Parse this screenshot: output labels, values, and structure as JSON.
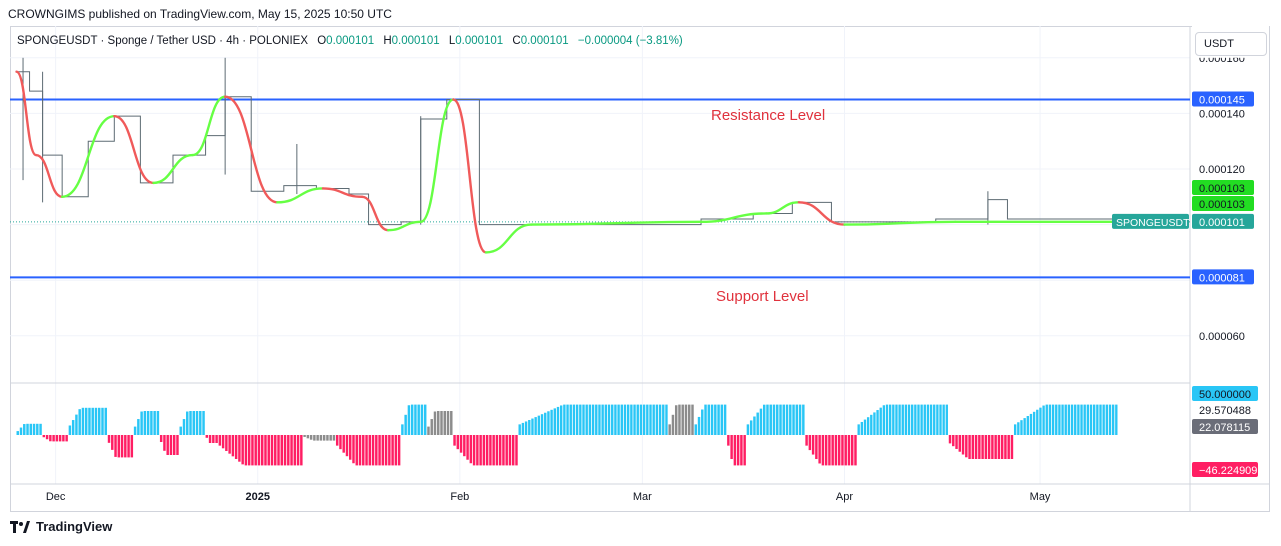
{
  "header": {
    "published": "CROWNGIMS published on TradingView.com, May 15, 2025 10:50 UTC"
  },
  "legend": {
    "symbol": "SPONGEUSDT · Sponge / Tether USD · 4h · POLONIEX",
    "o_label": "O",
    "o_value": "0.000101",
    "h_label": "H",
    "h_value": "0.000101",
    "l_label": "L",
    "l_value": "0.000101",
    "c_label": "C",
    "c_value": "0.000101",
    "change": "−0.000004 (−3.81%)"
  },
  "currency_button": "USDT",
  "annotations": {
    "resistance": "Resistance Level",
    "support": "Support Level"
  },
  "footer": {
    "brand": "TradingView"
  },
  "colors": {
    "level_line": "#2962ff",
    "ma_up": "#66ff44",
    "ma_down": "#f05a5a",
    "osc_pos": "#29c6f6",
    "osc_neg": "#ff1e63",
    "osc_neutral": "#8c8c8c",
    "price_badge": "#26a69a"
  },
  "chart_data": [
    {
      "type": "candlestick",
      "symbol": "SPONGEUSDT",
      "timeframe": "4h",
      "y_axis": {
        "ticks": [
          "0.000140",
          "0.000120",
          "0.000060"
        ],
        "partial_top_tick": "0.000160"
      },
      "x_axis": {
        "labels": [
          "Dec",
          "2025",
          "Feb",
          "Mar",
          "Apr",
          "May"
        ]
      },
      "horizontal_levels": [
        {
          "name": "Resistance Level",
          "value": 0.000145,
          "label": "0.000145"
        },
        {
          "name": "Support Level",
          "value": 8.1e-05,
          "label": "0.000081"
        }
      ],
      "price_labels": [
        {
          "label": "0.000103",
          "color": "#22dd22"
        },
        {
          "label": "0.000103",
          "color": "#22dd22"
        },
        {
          "label": "0.000101",
          "name": "SPONGEUSDT",
          "color": "#26a69a"
        }
      ],
      "close_path": [
        [
          "2024-11-25",
          0.000155
        ],
        [
          "2024-11-27",
          0.000148
        ],
        [
          "2024-11-29",
          0.000125
        ],
        [
          "2024-12-02",
          0.00011
        ],
        [
          "2024-12-06",
          0.00013
        ],
        [
          "2024-12-10",
          0.000139
        ],
        [
          "2024-12-14",
          0.000115
        ],
        [
          "2024-12-19",
          0.000125
        ],
        [
          "2024-12-24",
          0.000132
        ],
        [
          "2024-12-27",
          0.000146
        ],
        [
          "2024-12-31",
          0.000112
        ],
        [
          "2025-01-05",
          0.000114
        ],
        [
          "2025-01-10",
          0.000113
        ],
        [
          "2025-01-15",
          0.000111
        ],
        [
          "2025-01-18",
          0.0001
        ],
        [
          "2025-01-23",
          0.000101
        ],
        [
          "2025-01-26",
          0.000138
        ],
        [
          "2025-01-30",
          0.000145
        ],
        [
          "2025-02-04",
          0.0001
        ],
        [
          "2025-02-10",
          0.0001
        ],
        [
          "2025-03-01",
          0.0001
        ],
        [
          "2025-03-10",
          0.000102
        ],
        [
          "2025-03-18",
          0.000104
        ],
        [
          "2025-03-24",
          0.000108
        ],
        [
          "2025-03-30",
          0.000101
        ],
        [
          "2025-04-15",
          0.000102
        ],
        [
          "2025-04-23",
          0.000109
        ],
        [
          "2025-04-26",
          0.000102
        ],
        [
          "2025-05-15",
          0.000101
        ]
      ],
      "moving_average": [
        [
          "2024-11-25",
          0.000155
        ],
        [
          "2024-11-28",
          0.000125
        ],
        [
          "2024-12-02",
          0.00011
        ],
        [
          "2024-12-10",
          0.000139
        ],
        [
          "2024-12-16",
          0.000115
        ],
        [
          "2024-12-22",
          0.000125
        ],
        [
          "2024-12-27",
          0.000146
        ],
        [
          "2025-01-04",
          0.000108
        ],
        [
          "2025-01-11",
          0.000113
        ],
        [
          "2025-01-17",
          0.00011
        ],
        [
          "2025-01-21",
          9.8e-05
        ],
        [
          "2025-01-26",
          0.000101
        ],
        [
          "2025-01-31",
          0.000145
        ],
        [
          "2025-02-05",
          9e-05
        ],
        [
          "2025-02-12",
          0.0001
        ],
        [
          "2025-03-10",
          0.000101
        ],
        [
          "2025-03-20",
          0.000104
        ],
        [
          "2025-03-25",
          0.000108
        ],
        [
          "2025-04-01",
          0.0001
        ],
        [
          "2025-04-18",
          0.000101
        ],
        [
          "2025-05-15",
          0.000101
        ]
      ]
    },
    {
      "type": "bar",
      "name": "oscillator",
      "y_labels": [
        "50.000000",
        "29.570488",
        "22.078115",
        "−46.224909"
      ],
      "y_levels": [
        50.0,
        29.570488,
        22.078115,
        -46.224909
      ],
      "segments": [
        {
          "start": "2024-11-25",
          "end": "2024-11-29",
          "sign": "pos",
          "peak": 14
        },
        {
          "start": "2024-11-29",
          "end": "2024-12-03",
          "sign": "neg",
          "peak": -8
        },
        {
          "start": "2024-12-03",
          "end": "2024-12-09",
          "sign": "pos",
          "peak": 34
        },
        {
          "start": "2024-12-09",
          "end": "2024-12-13",
          "sign": "neg",
          "peak": -28
        },
        {
          "start": "2024-12-13",
          "end": "2024-12-17",
          "sign": "pos",
          "peak": 30
        },
        {
          "start": "2024-12-17",
          "end": "2024-12-20",
          "sign": "neg",
          "peak": -25
        },
        {
          "start": "2024-12-20",
          "end": "2024-12-24",
          "sign": "pos",
          "peak": 30
        },
        {
          "start": "2024-12-24",
          "end": "2024-12-26",
          "sign": "neg",
          "peak": -10
        },
        {
          "start": "2024-12-26",
          "end": "2025-01-08",
          "sign": "neg",
          "peak": -38
        },
        {
          "start": "2025-01-08",
          "end": "2025-01-13",
          "sign": "neutral",
          "peak": -7
        },
        {
          "start": "2025-01-13",
          "end": "2025-01-23",
          "sign": "neg",
          "peak": -38
        },
        {
          "start": "2025-01-23",
          "end": "2025-01-27",
          "sign": "pos",
          "peak": 38
        },
        {
          "start": "2025-01-27",
          "end": "2025-01-31",
          "sign": "neutral",
          "peak": 30
        },
        {
          "start": "2025-01-31",
          "end": "2025-02-10",
          "sign": "neg",
          "peak": -38
        },
        {
          "start": "2025-02-10",
          "end": "2025-03-05",
          "sign": "pos",
          "peak": 38
        },
        {
          "start": "2025-03-05",
          "end": "2025-03-09",
          "sign": "neutral",
          "peak": 38
        },
        {
          "start": "2025-03-09",
          "end": "2025-03-14",
          "sign": "pos",
          "peak": 38
        },
        {
          "start": "2025-03-14",
          "end": "2025-03-17",
          "sign": "neg",
          "peak": -38
        },
        {
          "start": "2025-03-17",
          "end": "2025-03-26",
          "sign": "pos",
          "peak": 38
        },
        {
          "start": "2025-03-26",
          "end": "2025-04-03",
          "sign": "neg",
          "peak": -38
        },
        {
          "start": "2025-04-03",
          "end": "2025-04-17",
          "sign": "pos",
          "peak": 38
        },
        {
          "start": "2025-04-17",
          "end": "2025-04-27",
          "sign": "neg",
          "peak": -30
        },
        {
          "start": "2025-04-27",
          "end": "2025-05-13",
          "sign": "pos",
          "peak": 38
        }
      ]
    }
  ]
}
